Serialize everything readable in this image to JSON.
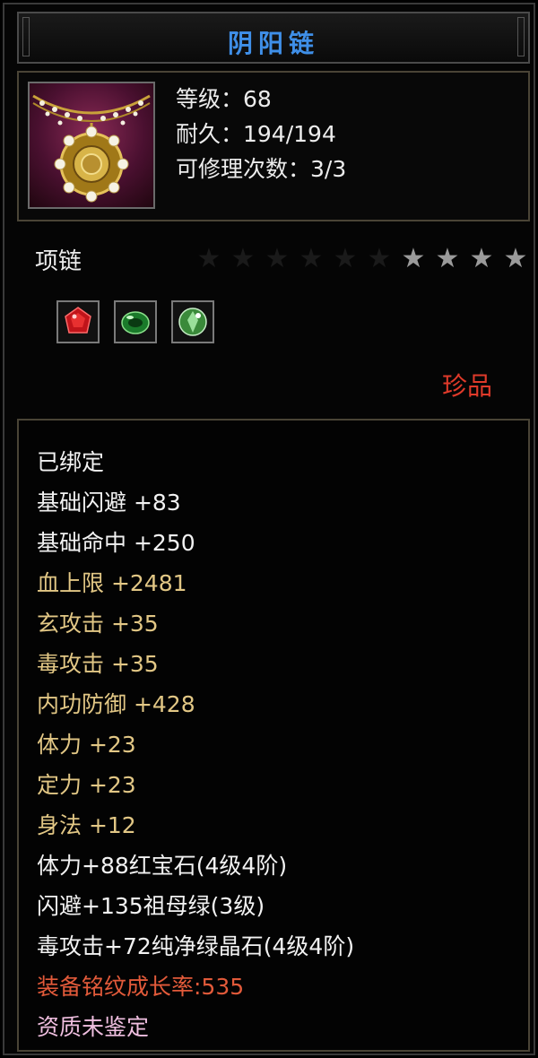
{
  "item": {
    "name": "阴阳链",
    "level_line": "等级：68",
    "durability_line": "耐久：194/194",
    "repair_line": "可修理次数：3/3",
    "type": "项链",
    "rarity": "珍品",
    "stars_total": 10,
    "stars_lit": 4
  },
  "icons": {
    "item": "necklace-icon",
    "gems": [
      "ruby-gem-icon",
      "emerald-gem-icon",
      "green-crystal-gem-icon"
    ]
  },
  "attributes": [
    {
      "text": "已绑定",
      "color": "white"
    },
    {
      "text": "基础闪避  +83",
      "color": "white"
    },
    {
      "text": "基础命中  +250",
      "color": "white"
    },
    {
      "text": "血上限  +2481",
      "color": "gold"
    },
    {
      "text": "玄攻击  +35",
      "color": "gold"
    },
    {
      "text": "毒攻击  +35",
      "color": "gold"
    },
    {
      "text": "内功防御  +428",
      "color": "gold"
    },
    {
      "text": "体力  +23",
      "color": "gold"
    },
    {
      "text": "定力  +23",
      "color": "gold"
    },
    {
      "text": "身法  +12",
      "color": "gold"
    },
    {
      "text": "体力+88红宝石(4级4阶)",
      "color": "white"
    },
    {
      "text": "闪避+135祖母绿(3级)",
      "color": "white"
    },
    {
      "text": "毒攻击+72纯净绿晶石(4级4阶)",
      "color": "white"
    },
    {
      "text": "装备铭纹成长率:535",
      "color": "orange"
    },
    {
      "text": "资质未鉴定",
      "color": "pink"
    }
  ],
  "colors": {
    "title": "#3f8fe8",
    "white": "#f2f2f2",
    "gold": "#e2c785",
    "orange": "#e25a3a",
    "pink": "#f0bfe0",
    "rarity": "#e03a2a"
  }
}
